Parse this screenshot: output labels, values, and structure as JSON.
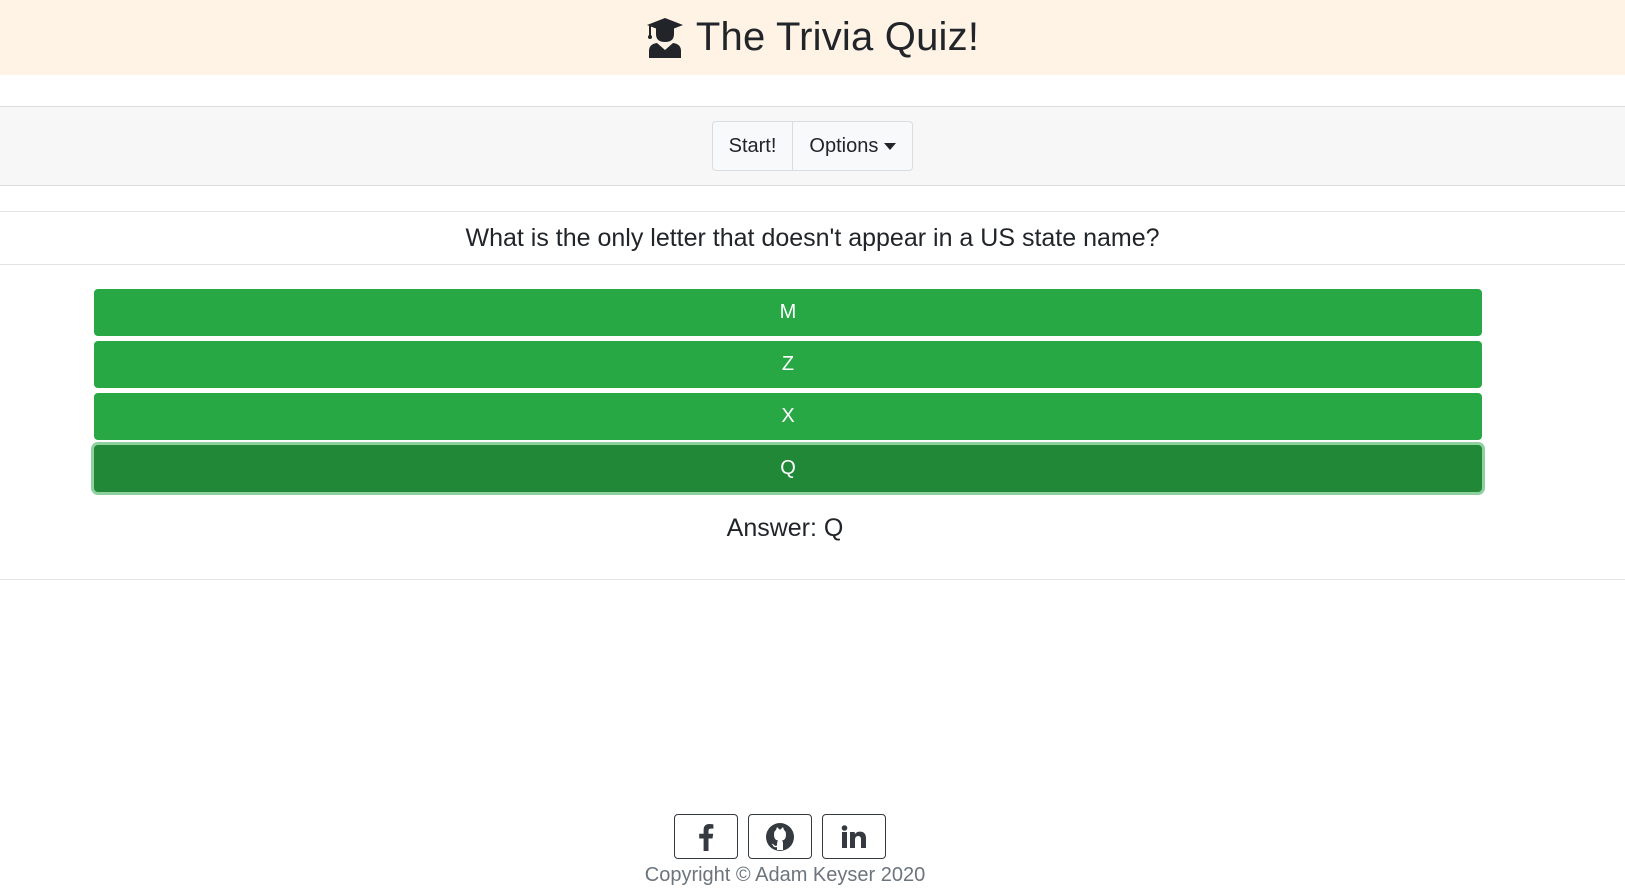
{
  "header": {
    "title": "The Trivia Quiz!",
    "icon": "graduate-icon"
  },
  "toolbar": {
    "start_label": "Start!",
    "options_label": "Options"
  },
  "question": {
    "text": "What is the only letter that doesn't appear in a US state name?"
  },
  "answers": [
    {
      "label": "M"
    },
    {
      "label": "Z"
    },
    {
      "label": "X"
    },
    {
      "label": "Q",
      "selected": true
    }
  ],
  "result": {
    "text": "Answer: Q"
  },
  "footer": {
    "social": [
      {
        "name": "facebook-icon"
      },
      {
        "name": "github-icon"
      },
      {
        "name": "linkedin-icon"
      }
    ],
    "copyright": "Copyright © Adam Keyser 2020"
  },
  "colors": {
    "header_bg": "#fff3e6",
    "answer_green": "#28a745",
    "answer_active": "#218838"
  }
}
